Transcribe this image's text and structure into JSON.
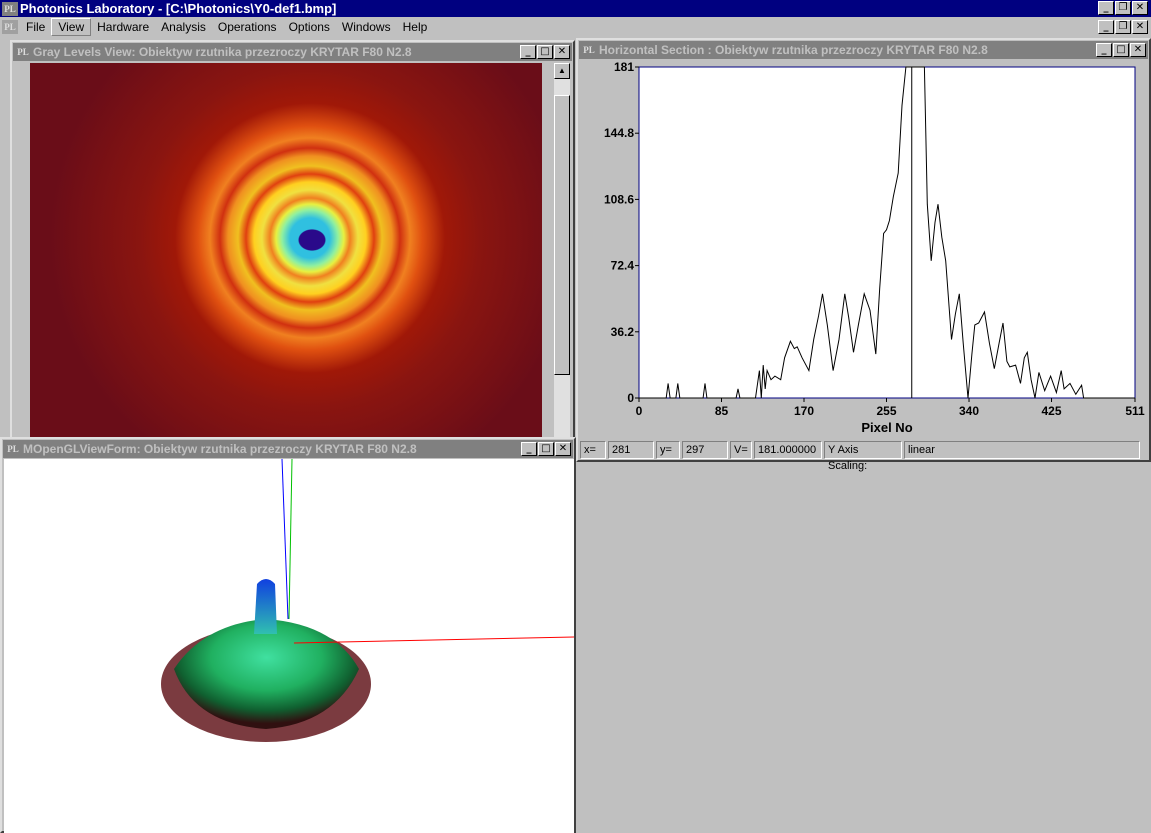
{
  "app": {
    "title": "Photonics Laboratory - [C:\\Photonics\\Y0-def1.bmp]",
    "logo": "PL"
  },
  "menu": [
    "File",
    "View",
    "Hardware",
    "Analysis",
    "Operations",
    "Options",
    "Windows",
    "Help"
  ],
  "menu_selected": "View",
  "windows": {
    "gray": {
      "title": "Gray Levels View: Obiektyw rzutnika przezroczy KRYTAR F80  N2.8"
    },
    "section": {
      "title": "Horizontal Section : Obiektyw rzutnika przezroczy KRYTAR F80  N2.8"
    },
    "gl": {
      "title": "MOpenGLViewForm: Obiektyw rzutnika przezroczy KRYTAR F80  N2.8"
    }
  },
  "status": {
    "x_label": "x=",
    "x": "281",
    "y_label": "y=",
    "y": "297",
    "v_label": "V=",
    "v": "181.000000",
    "scaling_label": "Y Axis Scaling:",
    "scaling": "linear"
  },
  "chart_data": {
    "type": "line",
    "xlabel": "Pixel No",
    "ylabel": "",
    "xlim": [
      0,
      511
    ],
    "ylim": [
      0,
      181
    ],
    "xticks": [
      "0",
      "85",
      "170",
      "255",
      "340",
      "425",
      "511"
    ],
    "yticks": [
      "0",
      "36.2",
      "72.4",
      "108.6",
      "144.8",
      "181"
    ],
    "cursor_x": 281,
    "x": [
      0,
      28,
      30,
      32,
      38,
      40,
      42,
      66,
      68,
      70,
      100,
      102,
      104,
      120,
      124,
      126,
      128,
      130,
      132,
      136,
      140,
      146,
      150,
      156,
      160,
      163,
      168,
      175,
      180,
      185,
      189,
      194,
      200,
      206,
      212,
      216,
      221,
      226,
      232,
      238,
      244,
      248,
      252,
      255,
      258,
      262,
      267,
      271,
      275,
      294,
      297,
      301,
      305,
      308,
      312,
      316,
      322,
      326,
      330,
      334,
      339,
      343,
      346,
      350,
      356,
      361,
      366,
      371,
      375,
      379,
      382,
      388,
      393,
      397,
      400,
      404,
      408,
      412,
      418,
      424,
      430,
      435,
      438,
      444,
      450,
      456,
      458,
      470,
      511
    ],
    "y": [
      0,
      0,
      8,
      0,
      0,
      8,
      0,
      0,
      8,
      0,
      0,
      5,
      0,
      0,
      15,
      0,
      18,
      5,
      15,
      10,
      12,
      10,
      22,
      31,
      27,
      28,
      22,
      15,
      32,
      45,
      57,
      40,
      15,
      32,
      57,
      44,
      25,
      40,
      57,
      48,
      24,
      60,
      90,
      92,
      97,
      110,
      123,
      160,
      181,
      181,
      106,
      75,
      96,
      106,
      88,
      75,
      32,
      46,
      57,
      30,
      0,
      24,
      40,
      41,
      47,
      30,
      16,
      30,
      41,
      20,
      17,
      18,
      8,
      22,
      25,
      10,
      0,
      14,
      4,
      12,
      3,
      15,
      5,
      8,
      2,
      7,
      0,
      0,
      0
    ]
  }
}
